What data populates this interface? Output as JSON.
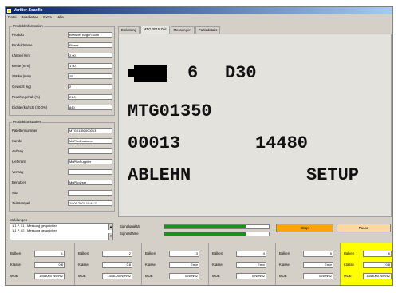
{
  "window": {
    "title": "Verifier-Scanfix"
  },
  "menu": [
    "Datei",
    "Bearbeiten",
    "Extra",
    "Hilfe"
  ],
  "product_group": {
    "title": "Produktinformation",
    "fields": [
      {
        "label": "Produkt",
        "value": "Breisher Bogen.sidm"
      },
      {
        "label": "Produktname",
        "value": "Planet"
      },
      {
        "label": "Länge (mm)",
        "value": "2.00"
      },
      {
        "label": "Breite (mm)",
        "value": "1.50"
      },
      {
        "label": "Stärke (mm)",
        "value": "25"
      },
      {
        "label": "Gewicht (kg)",
        "value": "2"
      },
      {
        "label": "Feuchtegehalt (%)",
        "value": "21.0"
      },
      {
        "label": "Dichte (kg/m3) (20.0%)",
        "value": "840"
      }
    ]
  },
  "production_group": {
    "title": "Produktionsdaten",
    "fields": [
      {
        "label": "Palettennummer",
        "value": "MTG01350000013"
      },
      {
        "label": "Kunde",
        "value": "MuPhoCustomer"
      },
      {
        "label": "Auftrag",
        "value": ""
      },
      {
        "label": "Lieferant",
        "value": "MuPhoSupplier"
      },
      {
        "label": "Vertrag",
        "value": ""
      },
      {
        "label": "Benutzer",
        "value": "MuPhoUser"
      },
      {
        "label": "Sitz",
        "value": ""
      },
      {
        "label": "Zeitstempel",
        "value": "11.09.2007 11:44:7"
      }
    ]
  },
  "tabs": [
    {
      "label": "Einleitung",
      "active": false
    },
    {
      "label": "MTG 3015 Zeit",
      "active": true
    },
    {
      "label": "Messungen",
      "active": false
    },
    {
      "label": "Partiedetails",
      "active": false
    }
  ],
  "display": {
    "line1_left": "6",
    "line1_right": "D30",
    "line2": "MTG01350",
    "line3_left": "00013",
    "line3_right": "14480",
    "line4_left": "ABLEHN",
    "line4_right": "SETUP"
  },
  "messages": {
    "title": "Meldungen",
    "lines": [
      "1.1 P. 01 - Messung gespeichert",
      "1.1 P. 02 - Messung gespeichert"
    ]
  },
  "signals": {
    "quality_label": "Signalqualität",
    "strength_label": "Signalstärke",
    "quality_level": 0.78,
    "strength_level": 0.78
  },
  "status": {
    "stop_label": "Stop",
    "stop_color": "#ffa500",
    "pause_label": "Pause",
    "pause_color": "#ffd9a0",
    "bar_color": "#1e8f1e",
    "highlight_color": "#ffff00"
  },
  "stations": [
    {
      "labels": [
        "Balken",
        "Klasse",
        "MOE"
      ],
      "values": [
        "1",
        "0.8",
        "1448000 N/mm2"
      ],
      "highlight": false
    },
    {
      "labels": [
        "Balken",
        "Klasse",
        "MOE"
      ],
      "values": [
        "2",
        "0.8",
        "1448000 N/mm2"
      ],
      "highlight": false
    },
    {
      "labels": [
        "Balken",
        "Klasse",
        "MOE"
      ],
      "values": [
        "3",
        "Error",
        "0 N/mm2"
      ],
      "highlight": false
    },
    {
      "labels": [
        "Balken",
        "Klasse",
        "MOE"
      ],
      "values": [
        "4",
        "Error",
        "0 N/mm2"
      ],
      "highlight": false
    },
    {
      "labels": [
        "Balken",
        "Klasse",
        "MOE"
      ],
      "values": [
        "5",
        "Error",
        "0 N/mm2"
      ],
      "highlight": false
    },
    {
      "labels": [
        "Balken",
        "Klasse",
        "MOE"
      ],
      "values": [
        "6",
        "0.8",
        "1448000 N/mm2"
      ],
      "highlight": true
    }
  ]
}
